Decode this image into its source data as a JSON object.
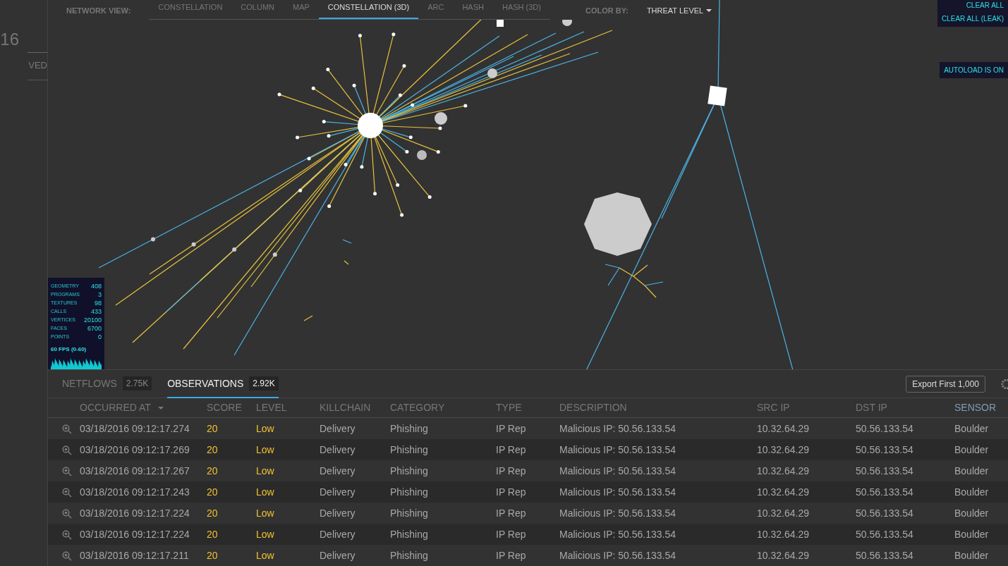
{
  "sidebar": {
    "texts": [
      "16",
      "VED"
    ]
  },
  "network_view": {
    "label": "NETWORK VIEW:",
    "tabs": [
      {
        "label": "CONSTELLATION",
        "selected": false
      },
      {
        "label": "COLUMN",
        "selected": false
      },
      {
        "label": "MAP",
        "selected": false
      },
      {
        "label": "CONSTELLATION (3D)",
        "selected": true
      },
      {
        "label": "ARC",
        "selected": false
      },
      {
        "label": "HASH",
        "selected": false
      },
      {
        "label": "HASH (3D)",
        "selected": false
      }
    ],
    "color_by_label": "COLOR BY:",
    "color_by_value": "THREAT LEVEL"
  },
  "overlay_buttons": [
    "CLEAR ALL",
    "CLEAR ALL (LEAK)"
  ],
  "autoload": "AUTOLOAD IS ON",
  "render_stats": {
    "rows": [
      {
        "label": "GEOMETRY",
        "value": "408"
      },
      {
        "label": "PROGRAMS",
        "value": "3"
      },
      {
        "label": "TEXTURES",
        "value": "98"
      },
      {
        "label": "CALLS",
        "value": "433"
      },
      {
        "label": "VERTICES",
        "value": "20100"
      },
      {
        "label": "FACES",
        "value": "6700"
      },
      {
        "label": "POINTS",
        "value": "0"
      }
    ],
    "fps": "60 FPS (0-60)"
  },
  "data_tabs": [
    {
      "label": "NETFLOWS",
      "count": "2.75K",
      "selected": false
    },
    {
      "label": "OBSERVATIONS",
      "count": "2.92K",
      "selected": true
    }
  ],
  "export_button": "Export First 1,000",
  "table": {
    "columns": [
      {
        "label": "OCCURRED AT",
        "sorted": true,
        "active": false
      },
      {
        "label": "SCORE",
        "sorted": false,
        "active": false
      },
      {
        "label": "LEVEL",
        "sorted": false,
        "active": false
      },
      {
        "label": "KILLCHAIN",
        "sorted": false,
        "active": false
      },
      {
        "label": "CATEGORY",
        "sorted": false,
        "active": false
      },
      {
        "label": "TYPE",
        "sorted": false,
        "active": false
      },
      {
        "label": "DESCRIPTION",
        "sorted": false,
        "active": false
      },
      {
        "label": "SRC IP",
        "sorted": false,
        "active": false
      },
      {
        "label": "DST IP",
        "sorted": false,
        "active": false
      },
      {
        "label": "SENSOR",
        "sorted": false,
        "active": true
      }
    ],
    "rows": [
      [
        "03/18/2016 09:12:17.274",
        "20",
        "Low",
        "Delivery",
        "Phishing",
        "IP Rep",
        "Malicious IP: 50.56.133.54",
        "10.32.64.29",
        "50.56.133.54",
        "Boulder"
      ],
      [
        "03/18/2016 09:12:17.269",
        "20",
        "Low",
        "Delivery",
        "Phishing",
        "IP Rep",
        "Malicious IP: 50.56.133.54",
        "10.32.64.29",
        "50.56.133.54",
        "Boulder"
      ],
      [
        "03/18/2016 09:12:17.267",
        "20",
        "Low",
        "Delivery",
        "Phishing",
        "IP Rep",
        "Malicious IP: 50.56.133.54",
        "10.32.64.29",
        "50.56.133.54",
        "Boulder"
      ],
      [
        "03/18/2016 09:12:17.243",
        "20",
        "Low",
        "Delivery",
        "Phishing",
        "IP Rep",
        "Malicious IP: 50.56.133.54",
        "10.32.64.29",
        "50.56.133.54",
        "Boulder"
      ],
      [
        "03/18/2016 09:12:17.224",
        "20",
        "Low",
        "Delivery",
        "Phishing",
        "IP Rep",
        "Malicious IP: 50.56.133.54",
        "10.32.64.29",
        "50.56.133.54",
        "Boulder"
      ],
      [
        "03/18/2016 09:12:17.224",
        "20",
        "Low",
        "Delivery",
        "Phishing",
        "IP Rep",
        "Malicious IP: 50.56.133.54",
        "10.32.64.29",
        "50.56.133.54",
        "Boulder"
      ],
      [
        "03/18/2016 09:12:17.211",
        "20",
        "Low",
        "Delivery",
        "Phishing",
        "IP Rep",
        "Malicious IP: 50.56.133.54",
        "10.32.64.29",
        "50.56.133.54",
        "Boulder"
      ]
    ]
  }
}
